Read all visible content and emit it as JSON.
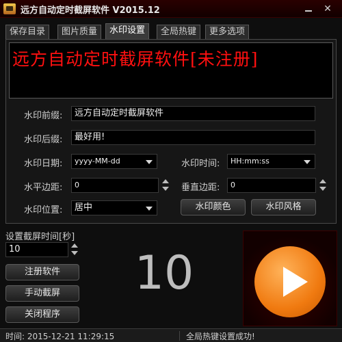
{
  "window": {
    "title": "远方自动定时截屏软件 V2015.12"
  },
  "tabs": [
    "保存目录",
    "图片质量",
    "水印设置",
    "全局热键",
    "更多选项"
  ],
  "active_tab": "水印设置",
  "banner": {
    "text": "远方自动定时截屏软件[未注册]",
    "color": "#ff1010"
  },
  "watermark": {
    "prefix_label": "水印前缀:",
    "prefix_value": "远方自动定时截屏软件",
    "suffix_label": "水印后缀:",
    "suffix_value": "最好用!",
    "date_label": "水印日期:",
    "date_value": "yyyy-MM-dd",
    "time_label": "水印时间:",
    "time_value": "HH:mm:ss",
    "hmargin_label": "水平边距:",
    "hmargin_value": "0",
    "vmargin_label": "垂直边距:",
    "vmargin_value": "0",
    "position_label": "水印位置:",
    "position_value": "居中",
    "color_button": "水印颜色",
    "style_button": "水印风格"
  },
  "interval": {
    "label": "设置截屏时间[秒]",
    "value": "10"
  },
  "buttons": {
    "register": "注册软件",
    "manual": "手动截屏",
    "close": "关闭程序"
  },
  "countdown": "10",
  "play_button": {
    "icon": "play-icon",
    "color": "#f07a10"
  },
  "status": {
    "time": "时间: 2015-12-21 11:29:15",
    "message": "全局热键设置成功!"
  }
}
